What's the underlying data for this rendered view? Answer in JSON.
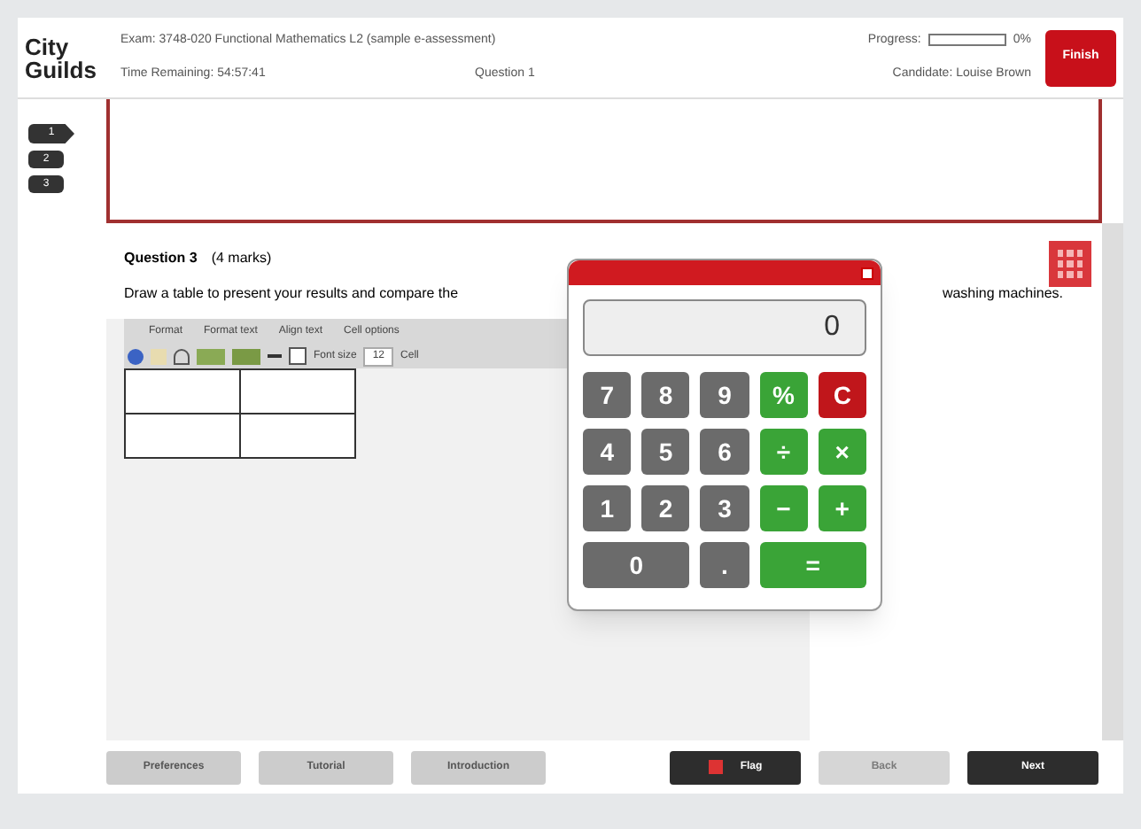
{
  "header": {
    "logo_top": "City",
    "logo_bottom": "Guilds",
    "exam": "Exam: 3748-020 Functional Mathematics L2 (sample e-assessment)",
    "time": "Time Remaining: 54:57:41",
    "question": "Question 1",
    "progress_label": "Progress:",
    "progress": {
      "level": 0
    },
    "progress_text": "0%",
    "candidate": "Candidate: Louise Brown",
    "finish": "Finish"
  },
  "nav": [
    {
      "label": "1",
      "selected": true
    },
    {
      "label": "2",
      "selected": false
    },
    {
      "label": "3",
      "selected": false
    }
  ],
  "question": {
    "title": "Question 3",
    "marks": "(4 marks)",
    "text_start": "Draw a table to present your results and compare the",
    "text_end": "washing machines."
  },
  "editor": {
    "menus": [
      "Format",
      "Format text",
      "Align text",
      "Cell options"
    ],
    "font_size_label": "Font size",
    "font_size": "12",
    "cell_label": "Cell"
  },
  "calculator": {
    "display": "0",
    "keys": [
      {
        "label": "7",
        "kind": "digit"
      },
      {
        "label": "8",
        "kind": "digit"
      },
      {
        "label": "9",
        "kind": "digit"
      },
      {
        "label": "%",
        "kind": "op"
      },
      {
        "label": "C",
        "kind": "clear"
      },
      {
        "label": "4",
        "kind": "digit"
      },
      {
        "label": "5",
        "kind": "digit"
      },
      {
        "label": "6",
        "kind": "digit"
      },
      {
        "label": "÷",
        "kind": "op"
      },
      {
        "label": "×",
        "kind": "op"
      },
      {
        "label": "1",
        "kind": "digit"
      },
      {
        "label": "2",
        "kind": "digit"
      },
      {
        "label": "3",
        "kind": "digit"
      },
      {
        "label": "−",
        "kind": "op"
      },
      {
        "label": "+",
        "kind": "op"
      },
      {
        "label": "0",
        "kind": "digit",
        "wide": true
      },
      {
        "label": ".",
        "kind": "digit"
      },
      {
        "label": "=",
        "kind": "op",
        "wide": true
      }
    ]
  },
  "footer": {
    "left": [
      "Preferences",
      "Tutorial",
      "Introduction"
    ],
    "flag": "Flag",
    "back": {
      "label": "Back",
      "disabled": true
    },
    "next": {
      "label": "Next",
      "disabled": false
    }
  }
}
